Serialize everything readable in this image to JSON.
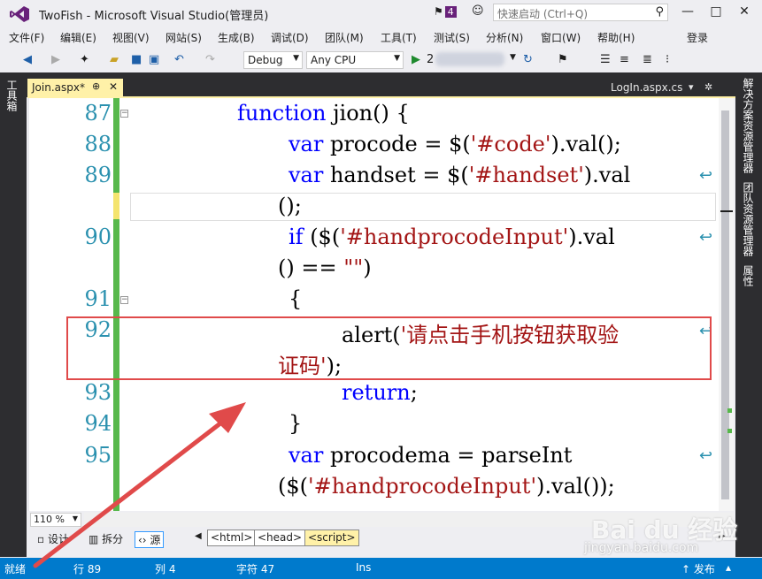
{
  "titlebar": {
    "title": "TwoFish - Microsoft Visual Studio(管理员)",
    "notification_count": "4",
    "quick_launch_placeholder": "快速启动 (Ctrl+Q)",
    "minimize": "—",
    "restore": "□",
    "close": "✕"
  },
  "menubar": {
    "items": [
      "文件(F)",
      "编辑(E)",
      "视图(V)",
      "网站(S)",
      "生成(B)",
      "调试(D)",
      "团队(M)",
      "工具(T)",
      "测试(S)",
      "分析(N)",
      "窗口(W)",
      "帮助(H)"
    ],
    "login": "登录"
  },
  "toolbar": {
    "config": "Debug",
    "platform": "Any CPU",
    "run_prefix": "2"
  },
  "left_rail": {
    "label": "工具箱"
  },
  "right_rail": {
    "labels": [
      "解决方案资源管理器",
      "团队资源管理器",
      "属性"
    ]
  },
  "tabs": {
    "active": "Join.aspx*",
    "pin": "⊕",
    "close": "✕",
    "other": "LogIn.aspx.cs"
  },
  "editor": {
    "line_numbers": [
      "87",
      "88",
      "89",
      "90",
      "91",
      "92",
      "93",
      "94",
      "95"
    ],
    "lines": {
      "l87_kw": "function",
      "l87_rest": " jion() {",
      "l88_kw": "var",
      "l88_rest": " procode = $(",
      "l88_str": "'#code'",
      "l88_end": ").val();",
      "l89_kw": "var",
      "l89_rest": " handset = $(",
      "l89_str": "'#handset'",
      "l89_end": ").val",
      "l89b": "();",
      "l90_kw": "if",
      "l90_rest": " ($(",
      "l90_str": "'#handprocodeInput'",
      "l90_end": ").val",
      "l90b_a": "() == ",
      "l90b_str": "\"\"",
      "l90b_b": ")",
      "l91": "{",
      "l92_a": "alert(",
      "l92_str": "'请点击手机按钮获取验",
      "l92b_str": "证码'",
      "l92b_end": ");",
      "l93_kw": "return",
      "l93_end": ";",
      "l94": "}",
      "l95_kw": "var",
      "l95_rest": " procodema = parseInt",
      "l95b_a": "($(",
      "l95b_str": "'#handprocodeInput'",
      "l95b_end": ").val());"
    }
  },
  "bottom": {
    "zoom": "110 %",
    "design": "设计",
    "split": "拆分",
    "source": "源",
    "crumbs": [
      "<html>",
      "<head>",
      "<script>"
    ]
  },
  "status": {
    "ready": "就绪",
    "line": "行 89",
    "col": "列 4",
    "char": "字符 47",
    "ins": "Ins",
    "publish": "↑ 发布"
  },
  "watermark": {
    "logo": "Bai du 经验",
    "url": "jingyan.baidu.com"
  }
}
